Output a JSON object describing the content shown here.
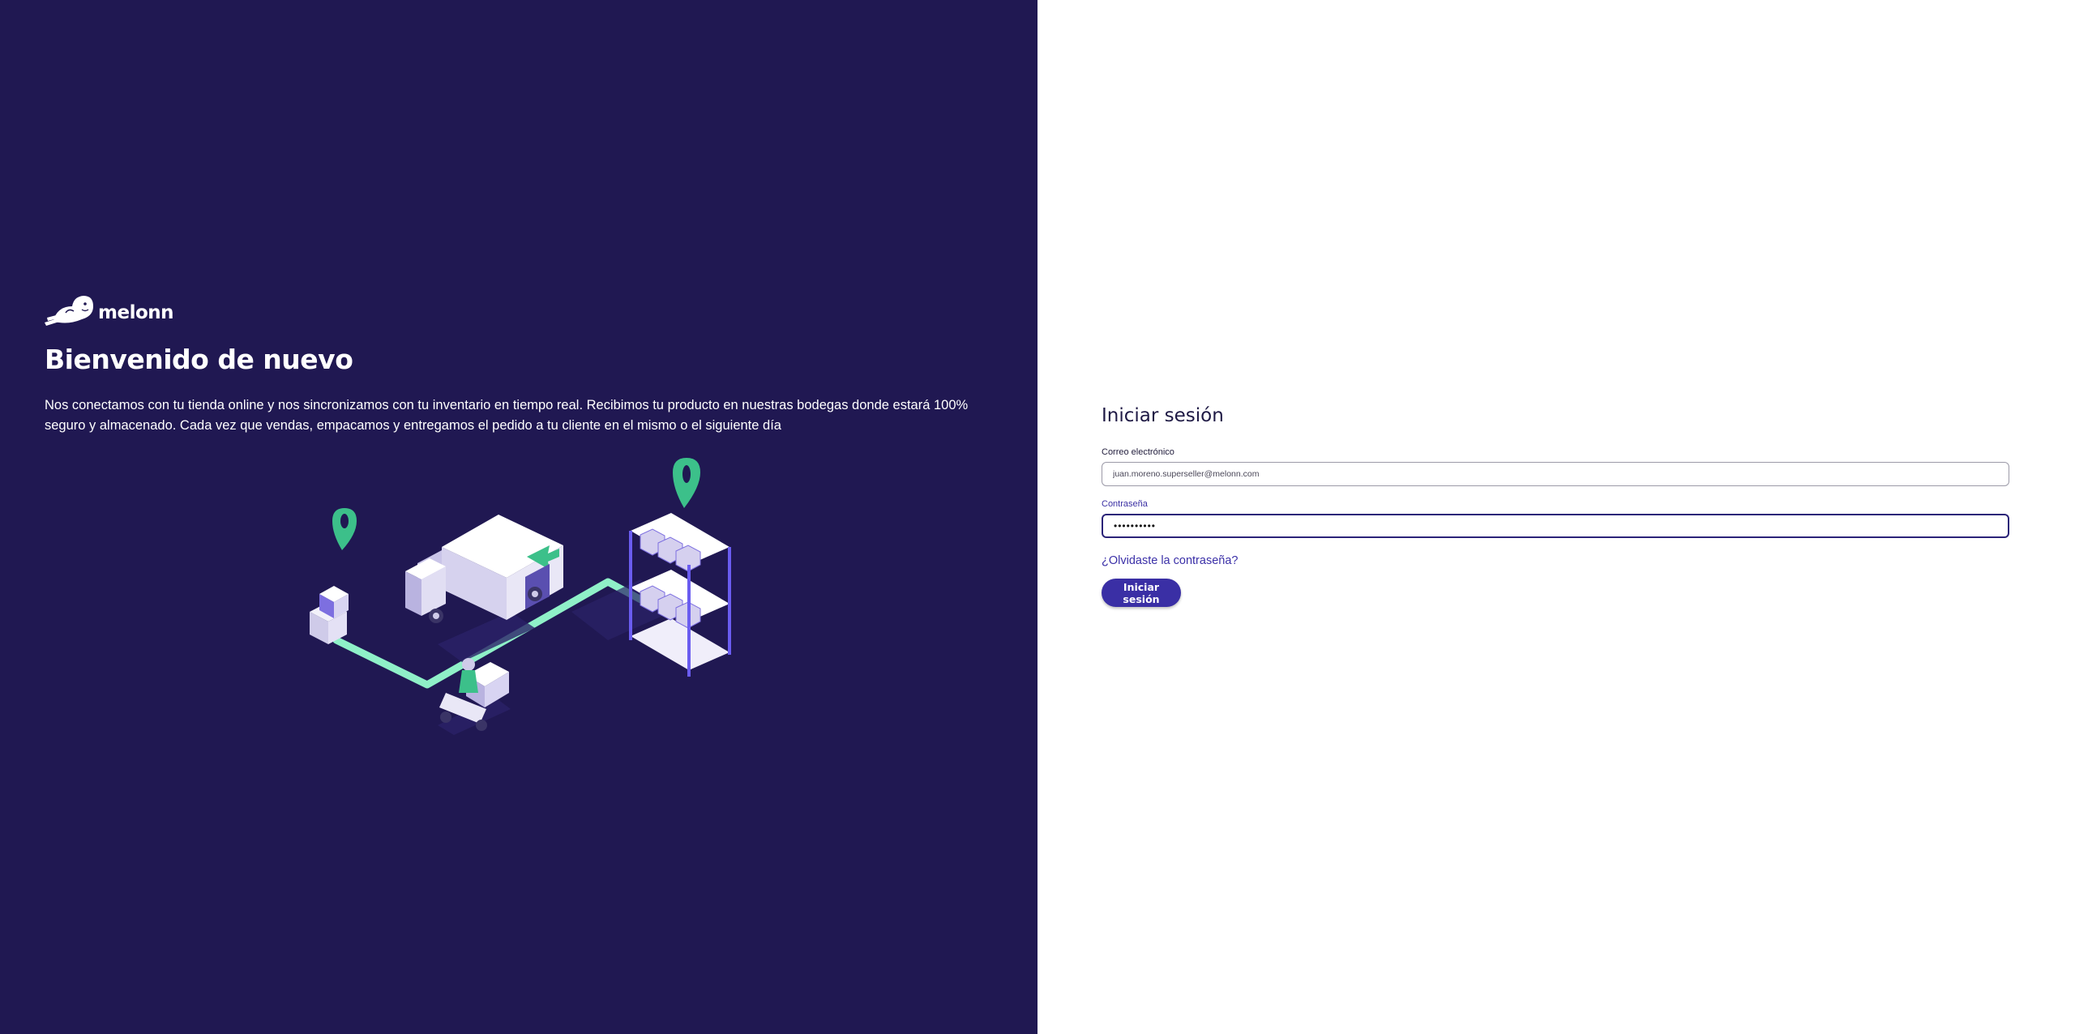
{
  "brand": {
    "name": "melonn",
    "primary_color": "#201852",
    "accent_color": "#3a2fa5",
    "green_color": "#33c48c"
  },
  "welcome": {
    "title": "Bienvenido de nuevo",
    "description": "Nos conectamos con tu tienda online y nos sincronizamos con tu inventario en tiempo real. Recibimos tu producto en nuestras bodegas donde estará 100% seguro y almacenado. Cada vez que vendas, empacamos y entregamos el pedido a tu cliente en el mismo o el siguiente día"
  },
  "login": {
    "title": "Iniciar sesión",
    "email_label": "Correo electrónico",
    "email_value": "juan.moreno.superseller@melonn.com",
    "password_label": "Contraseña",
    "password_value": "••••••••••",
    "forgot_link": "¿Olvidaste la contraseña?",
    "submit_label": "Iniciar sesión"
  },
  "icons": [
    "melonn-seal-logo",
    "map-pin-icon",
    "delivery-truck",
    "warehouse-shelves",
    "delivery-scooter",
    "package-boxes"
  ]
}
